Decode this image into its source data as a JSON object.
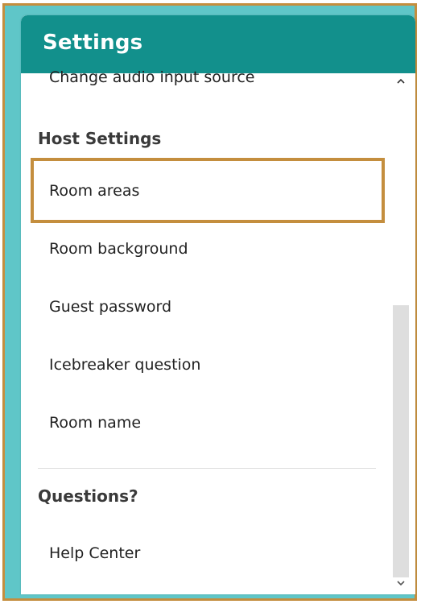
{
  "header": {
    "title": "Settings"
  },
  "list": {
    "top_item": "Change audio input source",
    "host_section": {
      "heading": "Host Settings",
      "items": [
        {
          "label": "Room areas"
        },
        {
          "label": "Room background"
        },
        {
          "label": "Guest password"
        },
        {
          "label": "Icebreaker question"
        },
        {
          "label": "Room name"
        }
      ]
    },
    "questions_section": {
      "heading": "Questions?",
      "items": [
        {
          "label": "Help Center"
        }
      ]
    }
  },
  "scrollbar": {
    "up_icon": "chevron-up-icon",
    "down_icon": "chevron-down-icon"
  },
  "colors": {
    "header": "#12908c",
    "backdrop": "#5fc6c8",
    "highlight": "#c48e3e"
  }
}
